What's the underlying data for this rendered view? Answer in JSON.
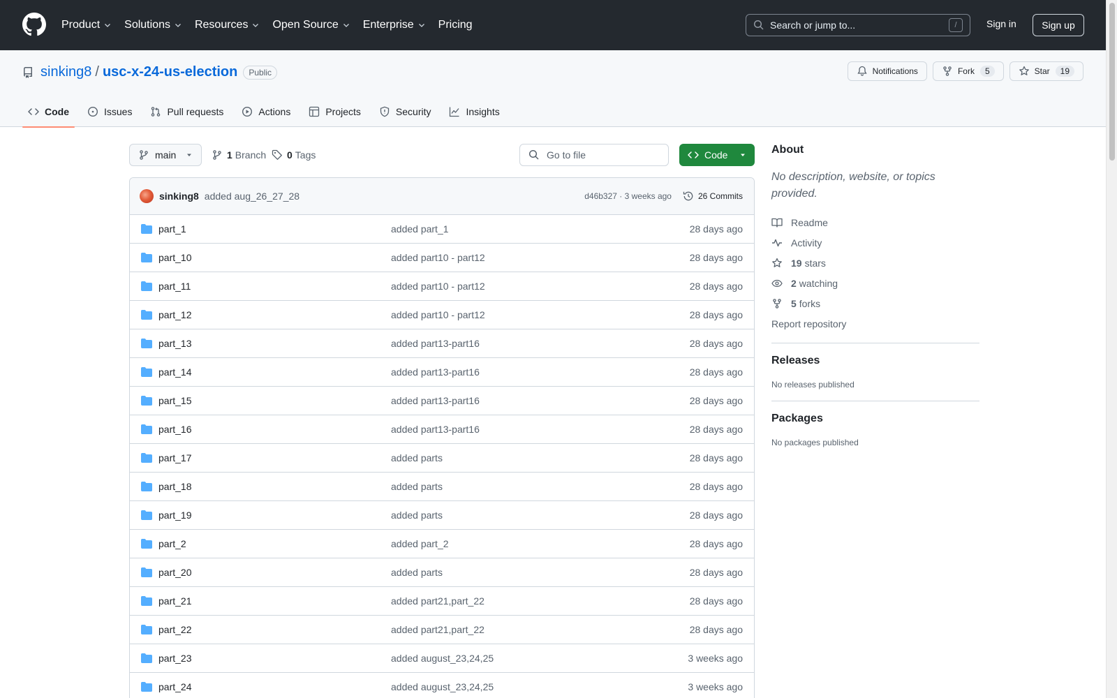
{
  "header": {
    "nav": [
      {
        "label": "Product",
        "dropdown": true
      },
      {
        "label": "Solutions",
        "dropdown": true
      },
      {
        "label": "Resources",
        "dropdown": true
      },
      {
        "label": "Open Source",
        "dropdown": true
      },
      {
        "label": "Enterprise",
        "dropdown": true
      },
      {
        "label": "Pricing",
        "dropdown": false
      }
    ],
    "search_placeholder": "Search or jump to...",
    "search_shortcut": "/",
    "sign_in": "Sign in",
    "sign_up": "Sign up"
  },
  "repo": {
    "owner": "sinking8",
    "separator": "/",
    "name": "usc-x-24-us-election",
    "visibility": "Public",
    "notifications_label": "Notifications",
    "fork_label": "Fork",
    "fork_count": "5",
    "star_label": "Star",
    "star_count": "19"
  },
  "tabs": [
    {
      "label": "Code",
      "icon": "code-icon",
      "active": true
    },
    {
      "label": "Issues",
      "icon": "issue-icon",
      "active": false
    },
    {
      "label": "Pull requests",
      "icon": "pull-request-icon",
      "active": false
    },
    {
      "label": "Actions",
      "icon": "play-icon",
      "active": false
    },
    {
      "label": "Projects",
      "icon": "table-icon",
      "active": false
    },
    {
      "label": "Security",
      "icon": "shield-icon",
      "active": false
    },
    {
      "label": "Insights",
      "icon": "graph-icon",
      "active": false
    }
  ],
  "toolbar": {
    "branch": "main",
    "branch_count": "1",
    "branch_label": "Branch",
    "tag_count": "0",
    "tag_label": "Tags",
    "go_to_file": "Go to file",
    "code_button": "Code"
  },
  "commit": {
    "author": "sinking8",
    "message": "added aug_26_27_28",
    "hash_time": "d46b327 · 3 weeks ago",
    "commits_count": "26 Commits"
  },
  "files": [
    {
      "name": "part_1",
      "message": "added part_1",
      "age": "28 days ago"
    },
    {
      "name": "part_10",
      "message": "added part10 - part12",
      "age": "28 days ago"
    },
    {
      "name": "part_11",
      "message": "added part10 - part12",
      "age": "28 days ago"
    },
    {
      "name": "part_12",
      "message": "added part10 - part12",
      "age": "28 days ago"
    },
    {
      "name": "part_13",
      "message": "added part13-part16",
      "age": "28 days ago"
    },
    {
      "name": "part_14",
      "message": "added part13-part16",
      "age": "28 days ago"
    },
    {
      "name": "part_15",
      "message": "added part13-part16",
      "age": "28 days ago"
    },
    {
      "name": "part_16",
      "message": "added part13-part16",
      "age": "28 days ago"
    },
    {
      "name": "part_17",
      "message": "added parts",
      "age": "28 days ago"
    },
    {
      "name": "part_18",
      "message": "added parts",
      "age": "28 days ago"
    },
    {
      "name": "part_19",
      "message": "added parts",
      "age": "28 days ago"
    },
    {
      "name": "part_2",
      "message": "added part_2",
      "age": "28 days ago"
    },
    {
      "name": "part_20",
      "message": "added parts",
      "age": "28 days ago"
    },
    {
      "name": "part_21",
      "message": "added part21,part_22",
      "age": "28 days ago"
    },
    {
      "name": "part_22",
      "message": "added part21,part_22",
      "age": "28 days ago"
    },
    {
      "name": "part_23",
      "message": "added august_23,24,25",
      "age": "3 weeks ago"
    },
    {
      "name": "part_24",
      "message": "added august_23,24,25",
      "age": "3 weeks ago"
    }
  ],
  "about": {
    "title": "About",
    "description": "No description, website, or topics provided.",
    "readme": "Readme",
    "activity": "Activity",
    "stars_count": "19",
    "stars_label": "stars",
    "watching_count": "2",
    "watching_label": "watching",
    "forks_count": "5",
    "forks_label": "forks",
    "report": "Report repository"
  },
  "releases": {
    "title": "Releases",
    "empty": "No releases published"
  },
  "packages": {
    "title": "Packages",
    "empty": "No packages published"
  },
  "colors": {
    "header_bg": "#24292f",
    "link": "#0969da",
    "code_button": "#1f883d",
    "active_tab_underline": "#fd8c73",
    "folder": "#54aeff"
  }
}
